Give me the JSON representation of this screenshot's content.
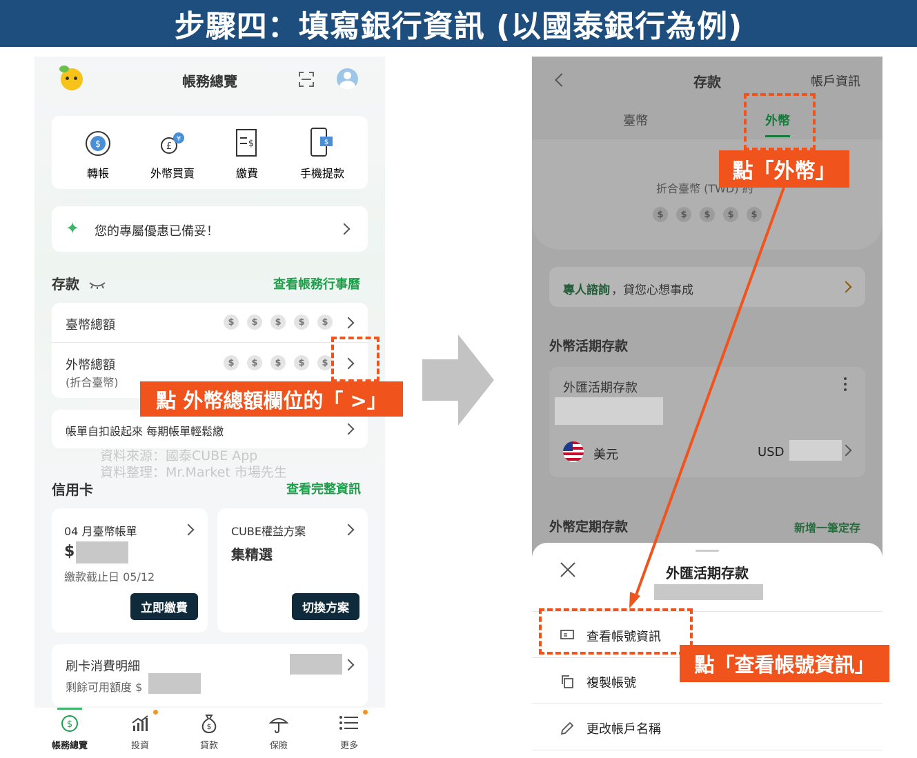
{
  "title": "步驟四：填寫銀行資訊 (以國泰銀行為例)",
  "left": {
    "header_title": "帳務總覽",
    "quick_actions": [
      "轉帳",
      "外幣買賣",
      "繳費",
      "手機提款"
    ],
    "promo_text": "您的專屬優惠已備妥！",
    "deposit_section": "存款",
    "deposit_link": "查看帳務行事曆",
    "twd_total": "臺幣總額",
    "fx_total": "外幣總額",
    "fx_total_sub": "(折合臺幣)",
    "dollar_sign": "$",
    "autopay_text": "帳單自扣設起來 每期帳單輕鬆繳",
    "source_line1": "資料來源：國泰CUBE App",
    "source_line2": "資料整理：Mr.Market 市場先生",
    "credit_section": "信用卡",
    "credit_link": "查看完整資訊",
    "bill_title": "04 月臺幣帳單",
    "bill_amount_prefix": "$",
    "bill_due": "繳款截止日 05/12",
    "pay_now": "立即繳費",
    "plan_title": "CUBE權益方案",
    "plan_name": "集精選",
    "switch_plan": "切換方案",
    "card_detail": "刷卡消費明細",
    "credit_remaining": "剩餘可用額度 $",
    "nav": [
      "帳務總覽",
      "投資",
      "貸款",
      "保險",
      "更多"
    ],
    "callout": "點 外幣總額欄位的「 >」"
  },
  "right": {
    "header_title": "存款",
    "header_right": "帳戶資訊",
    "tab_twd": "臺幣",
    "tab_fx": "外幣",
    "converted_label": "折合臺幣 (TWD) 約",
    "consult_bold": "專人諮詢",
    "consult_rest": "，貸您心想事成",
    "fx_demand": "外幣活期存款",
    "fx_demand_card": "外匯活期存款",
    "usd_name": "美元",
    "usd_code": "USD",
    "fx_time": "外幣定期存款",
    "add_time": "新增一筆定存",
    "sheet_title": "外匯活期存款",
    "menu": [
      "查看帳號資訊",
      "複製帳號",
      "更改帳戶名稱"
    ],
    "callout_tab": "點「外幣」",
    "callout_menu": "點「查看帳號資訊」"
  },
  "colors": {
    "banner": "#1d4e7e",
    "accent_orange": "#f0531c",
    "green": "#1e9e4b",
    "dark_button": "#0f2a3a"
  }
}
